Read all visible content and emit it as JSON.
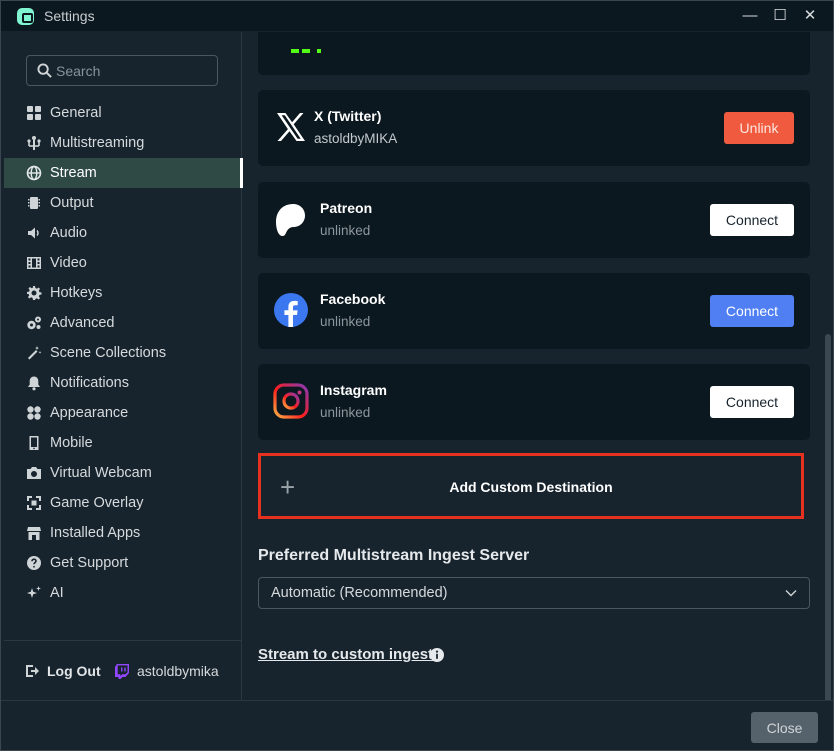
{
  "window": {
    "title": "Settings",
    "minimize": "—",
    "maximize": "☐",
    "close": "✕"
  },
  "search": {
    "placeholder": "Search"
  },
  "sidebar": {
    "items": [
      {
        "label": "General",
        "icon": "grid-icon"
      },
      {
        "label": "Multistreaming",
        "icon": "multistream-icon"
      },
      {
        "label": "Stream",
        "icon": "globe-icon",
        "active": true
      },
      {
        "label": "Output",
        "icon": "chip-icon"
      },
      {
        "label": "Audio",
        "icon": "speaker-icon"
      },
      {
        "label": "Video",
        "icon": "film-icon"
      },
      {
        "label": "Hotkeys",
        "icon": "gear-icon"
      },
      {
        "label": "Advanced",
        "icon": "gears-icon"
      },
      {
        "label": "Scene Collections",
        "icon": "wand-icon"
      },
      {
        "label": "Notifications",
        "icon": "bell-icon"
      },
      {
        "label": "Appearance",
        "icon": "palette-icon"
      },
      {
        "label": "Mobile",
        "icon": "phone-icon"
      },
      {
        "label": "Virtual Webcam",
        "icon": "camera-icon"
      },
      {
        "label": "Game Overlay",
        "icon": "overlay-icon"
      },
      {
        "label": "Installed Apps",
        "icon": "store-icon"
      },
      {
        "label": "Get Support",
        "icon": "help-icon"
      },
      {
        "label": "AI",
        "icon": "sparkle-icon"
      }
    ],
    "logout_label": "Log Out",
    "username": "astoldbymika"
  },
  "platforms": [
    {
      "name": "X (Twitter)",
      "status": "astoldbyMIKA",
      "action": "Unlink",
      "logo": "x-logo-icon"
    },
    {
      "name": "Patreon",
      "status": "unlinked",
      "action": "Connect",
      "logo": "patreon-logo-icon"
    },
    {
      "name": "Facebook",
      "status": "unlinked",
      "action": "Connect",
      "logo": "facebook-logo-icon"
    },
    {
      "name": "Instagram",
      "status": "unlinked",
      "action": "Connect",
      "logo": "instagram-logo-icon"
    }
  ],
  "add_destination": {
    "plus": "+",
    "label": "Add Custom Destination"
  },
  "ingest": {
    "title": "Preferred Multistream Ingest Server",
    "selected": "Automatic (Recommended)"
  },
  "custom_ingest_link": "Stream to custom ingest",
  "footer": {
    "close_label": "Close"
  },
  "colors": {
    "accent": "#2f4a45",
    "unlink": "#f05b40",
    "facebook": "#4f7ff2",
    "highlight": "#e5311e"
  }
}
